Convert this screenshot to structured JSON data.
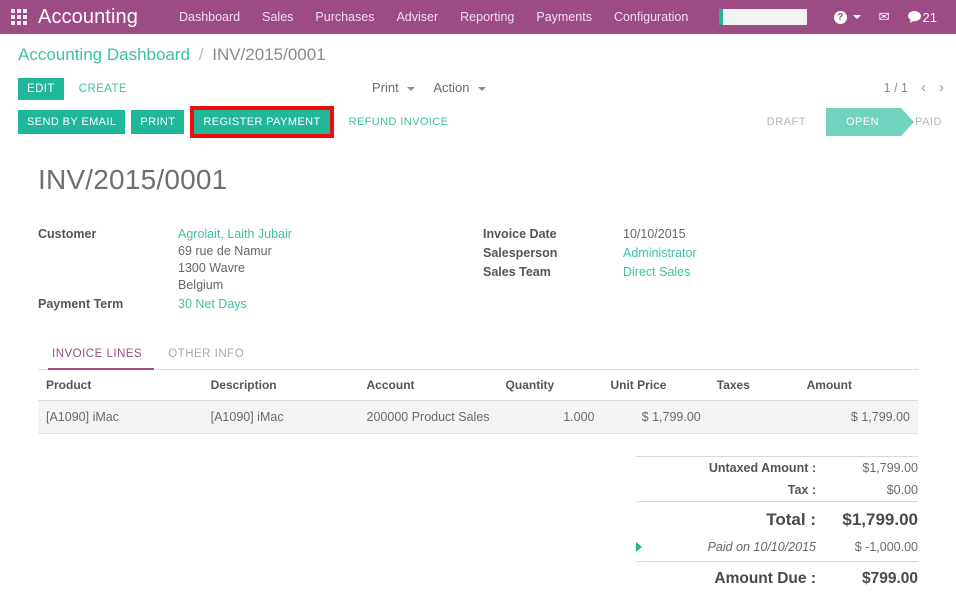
{
  "navbar": {
    "apps_icon": "apps-grid-icon",
    "brand": "Accounting",
    "menu": [
      {
        "label": "Dashboard"
      },
      {
        "label": "Sales"
      },
      {
        "label": "Purchases"
      },
      {
        "label": "Adviser"
      },
      {
        "label": "Reporting"
      },
      {
        "label": "Payments"
      },
      {
        "label": "Configuration"
      }
    ],
    "search_value": "",
    "help_icon": "help-icon",
    "help_glyph": "?",
    "mail_icon": "envelope-icon",
    "mail_glyph": "✉",
    "messages_icon": "chat-bubble-icon",
    "messages_glyph": "💬",
    "messages_count": "21",
    "colors": {
      "brand_purple": "#9d4b85",
      "accent_teal": "#21b799"
    }
  },
  "breadcrumb": {
    "parent": "Accounting Dashboard",
    "separator": "/",
    "current": "INV/2015/0001"
  },
  "control_panel": {
    "edit_label": "EDIT",
    "create_label": "CREATE",
    "print_label": "Print",
    "action_label": "Action",
    "pager_text": "1 / 1",
    "prev_glyph": "‹",
    "next_glyph": "›"
  },
  "action_bar": {
    "buttons": [
      {
        "label": "SEND BY EMAIL",
        "style": "primary",
        "highlighted": false
      },
      {
        "label": "PRINT",
        "style": "primary",
        "highlighted": false
      },
      {
        "label": "REGISTER PAYMENT",
        "style": "primary",
        "highlighted": true
      },
      {
        "label": "REFUND INVOICE",
        "style": "link",
        "highlighted": false
      }
    ],
    "highlight_color": "#f30b0b",
    "statuses": [
      {
        "label": "DRAFT",
        "active": false
      },
      {
        "label": "OPEN",
        "active": true
      },
      {
        "label": "PAID",
        "active": false
      }
    ]
  },
  "document": {
    "title": "INV/2015/0001",
    "left_fields": {
      "customer_label": "Customer",
      "customer_name": "Agrolait, Laith Jubair",
      "customer_address": [
        "69 rue de Namur",
        "1300 Wavre",
        "Belgium"
      ],
      "payment_term_label": "Payment Term",
      "payment_term_value": "30 Net Days"
    },
    "right_fields": [
      {
        "label": "Invoice Date",
        "value": "10/10/2015",
        "link": false
      },
      {
        "label": "Salesperson",
        "value": "Administrator",
        "link": true
      },
      {
        "label": "Sales Team",
        "value": "Direct Sales",
        "link": true
      }
    ]
  },
  "notebook": {
    "tabs": [
      {
        "label": "INVOICE LINES",
        "active": true
      },
      {
        "label": "OTHER INFO",
        "active": false
      }
    ]
  },
  "lines_table": {
    "columns": [
      {
        "label": "Product",
        "align": "left"
      },
      {
        "label": "Description",
        "align": "left"
      },
      {
        "label": "Account",
        "align": "left"
      },
      {
        "label": "Quantity",
        "align": "right"
      },
      {
        "label": "Unit Price",
        "align": "right"
      },
      {
        "label": "Taxes",
        "align": "right"
      },
      {
        "label": "Amount",
        "align": "right"
      }
    ],
    "rows": [
      {
        "product": "[A1090] iMac",
        "description": "[A1090] iMac",
        "account": "200000 Product Sales",
        "quantity": "1.000",
        "unit_price": "$ 1,799.00",
        "taxes": "",
        "amount": "$ 1,799.00"
      }
    ]
  },
  "totals": {
    "untaxed_label": "Untaxed Amount :",
    "untaxed_value": "$1,799.00",
    "tax_label": "Tax :",
    "tax_value": "$0.00",
    "total_label": "Total :",
    "total_value": "$1,799.00",
    "payment_caret": "expand-caret-icon",
    "payment_label": "Paid on 10/10/2015",
    "payment_value": "$ -1,000.00",
    "due_label": "Amount Due :",
    "due_value": "$799.00"
  }
}
